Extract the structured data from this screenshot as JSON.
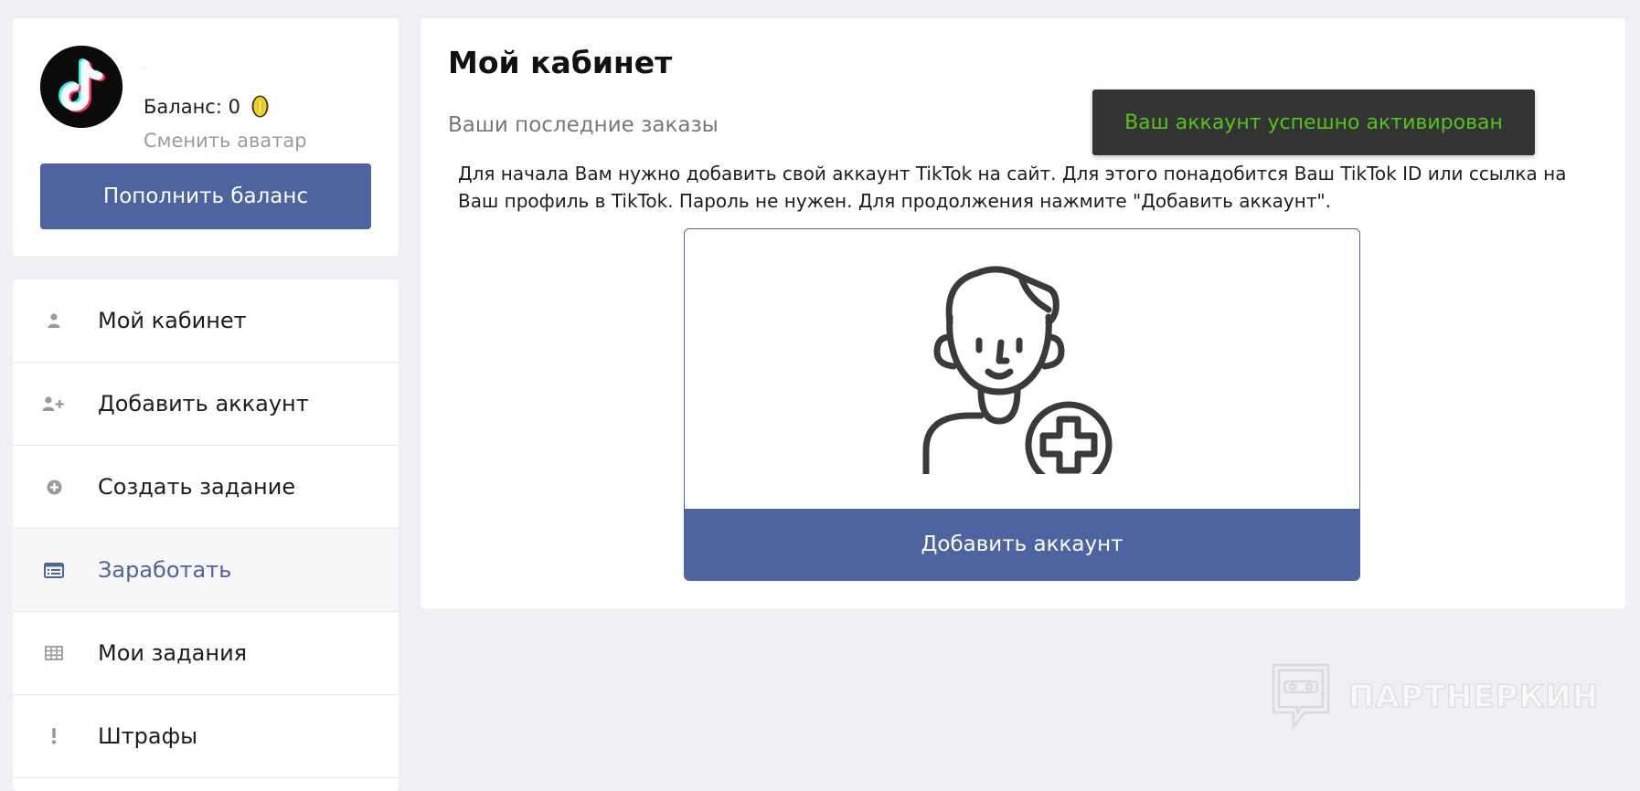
{
  "profile": {
    "avatar_icon": "tiktok-logo-icon",
    "name": "'",
    "balance_label": "Баланс: 0",
    "coin_icon": "coin-icon",
    "change_avatar_label": "Сменить аватар",
    "topup_label": "Пополнить баланс"
  },
  "sidebar": {
    "items": [
      {
        "label": "Мой кабинет",
        "icon": "user-icon",
        "active": false
      },
      {
        "label": "Добавить аккаунт",
        "icon": "user-plus-icon",
        "active": false
      },
      {
        "label": "Создать задание",
        "icon": "plus-circle-icon",
        "active": false
      },
      {
        "label": "Заработать",
        "icon": "list-alt-icon",
        "active": true
      },
      {
        "label": "Мои задания",
        "icon": "table-icon",
        "active": false
      },
      {
        "label": "Штрафы",
        "icon": "exclamation-icon",
        "active": false
      }
    ]
  },
  "main": {
    "title": "Мой кабинет",
    "subtitle": "Ваши последние заказы",
    "intro": "Для начала Вам нужно добавить свой аккаунт TikTok на сайт. Для этого понадобится Ваш TikTok ID или ссылка на Ваш профиль в TikTok. Пароль не нужен. Для продолжения нажмите \"Добавить аккаунт\".",
    "add_card": {
      "illustration_icon": "user-add-icon",
      "button_label": "Добавить аккаунт"
    }
  },
  "toast": {
    "message": "Ваш аккаунт успешно активирован"
  },
  "watermark": {
    "text": "ПАРТНЕРКИН"
  },
  "colors": {
    "accent": "#4e64a0",
    "page_background": "#eef0f3",
    "toast_background": "#333333",
    "toast_text": "#52c41a",
    "muted_text": "#9b9b9b"
  }
}
